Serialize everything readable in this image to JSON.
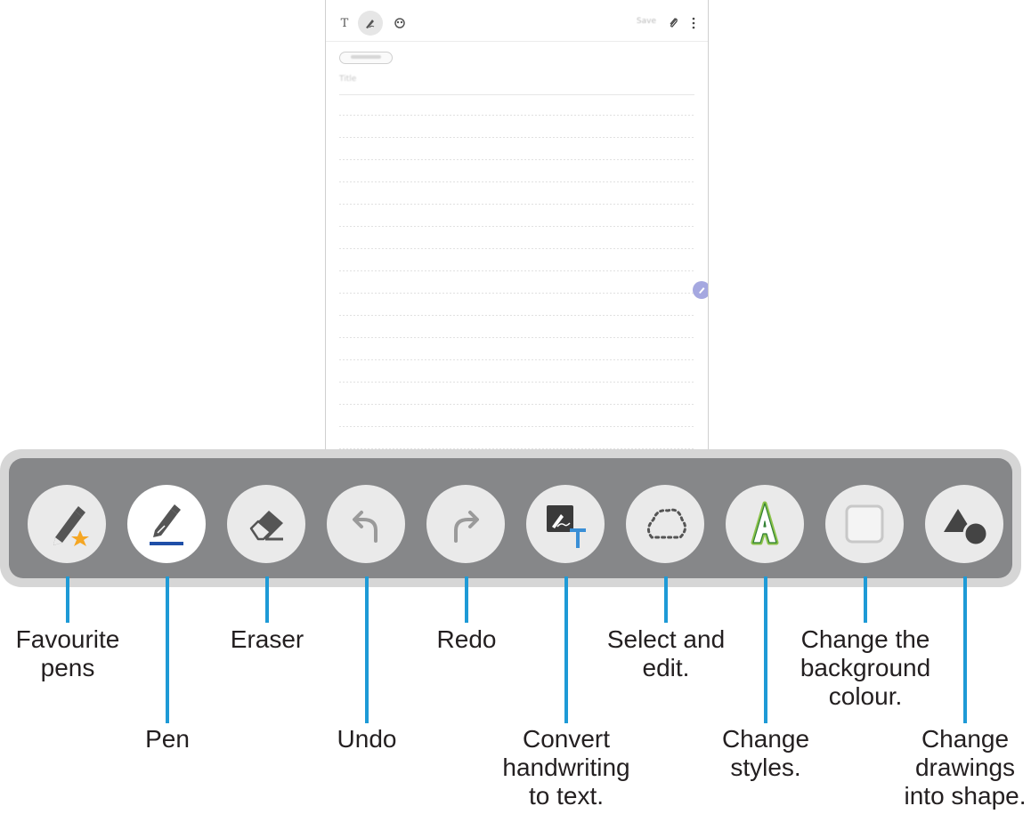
{
  "screen": {
    "toolbar": {
      "text_icon": "T",
      "save_label": "Save",
      "pen_icon": "pen-mode-icon",
      "brush_icon": "brush-icon",
      "attach_icon": "attach-icon",
      "more_icon": "more-options-icon"
    },
    "category_placeholder": "",
    "title_placeholder": "Title",
    "floating_button_icon": "pen-fab-icon"
  },
  "tools": [
    {
      "id": "favourite-pens",
      "icon": "favourite-pen-icon",
      "label": "Favourite\npens",
      "active": false
    },
    {
      "id": "pen",
      "icon": "pen-icon",
      "label": "Pen",
      "active": true
    },
    {
      "id": "eraser",
      "icon": "eraser-icon",
      "label": "Eraser",
      "active": false
    },
    {
      "id": "undo",
      "icon": "undo-icon",
      "label": "Undo",
      "active": false
    },
    {
      "id": "redo",
      "icon": "redo-icon",
      "label": "Redo",
      "active": false
    },
    {
      "id": "convert",
      "icon": "handwriting-to-text-icon",
      "label": "Convert\nhandwriting\nto text.",
      "active": false
    },
    {
      "id": "select",
      "icon": "lasso-select-icon",
      "label": "Select and\nedit.",
      "active": false
    },
    {
      "id": "styles",
      "icon": "change-styles-icon",
      "label": "Change\nstyles.",
      "active": false
    },
    {
      "id": "background",
      "icon": "background-colour-icon",
      "label": "Change the\nbackground\ncolour.",
      "active": false
    },
    {
      "id": "shape",
      "icon": "shape-icon",
      "label": "Change\ndrawings\ninto shape.",
      "active": false
    }
  ],
  "colors": {
    "leader_line": "#1e9ad6",
    "toolbar_frame": "#d6d6d6",
    "toolbar_bg": "#868789",
    "button_bg": "#eaeaea",
    "pen_underline": "#1f4fa8",
    "star": "#f5a623",
    "styles_green": "#8bc34a",
    "text_blue": "#3a8fd6"
  }
}
